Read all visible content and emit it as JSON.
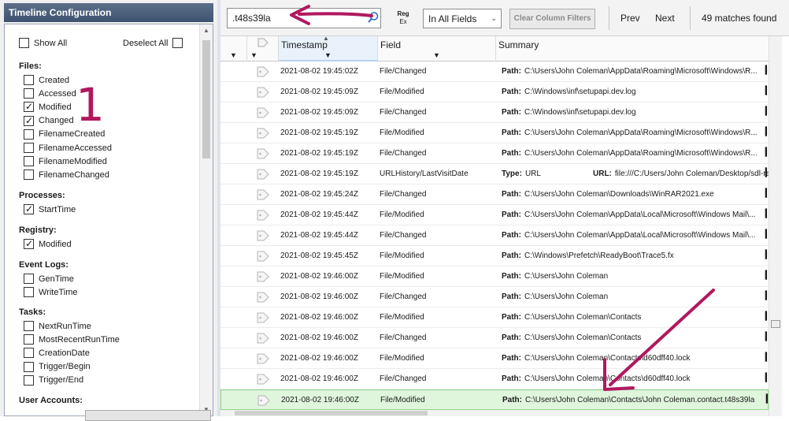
{
  "left_panel": {
    "title": "Timeline Configuration",
    "show_all": {
      "label": "Show All",
      "checked": false
    },
    "deselect_all": {
      "label": "Deselect All",
      "checked": false
    },
    "sections": [
      {
        "heading": "Files:",
        "items": [
          {
            "label": "Created",
            "checked": false
          },
          {
            "label": "Accessed",
            "checked": false
          },
          {
            "label": "Modified",
            "checked": true
          },
          {
            "label": "Changed",
            "checked": true
          },
          {
            "label": "FilenameCreated",
            "checked": false
          },
          {
            "label": "FilenameAccessed",
            "checked": false
          },
          {
            "label": "FilenameModified",
            "checked": false
          },
          {
            "label": "FilenameChanged",
            "checked": false
          }
        ]
      },
      {
        "heading": "Processes:",
        "items": [
          {
            "label": "StartTime",
            "checked": true
          }
        ]
      },
      {
        "heading": "Registry:",
        "items": [
          {
            "label": "Modified",
            "checked": true
          }
        ]
      },
      {
        "heading": "Event Logs:",
        "items": [
          {
            "label": "GenTime",
            "checked": false
          },
          {
            "label": "WriteTime",
            "checked": false
          }
        ]
      },
      {
        "heading": "Tasks:",
        "items": [
          {
            "label": "NextRunTime",
            "checked": false
          },
          {
            "label": "MostRecentRunTime",
            "checked": false
          },
          {
            "label": "CreationDate",
            "checked": false
          },
          {
            "label": "Trigger/Begin",
            "checked": false
          },
          {
            "label": "Trigger/End",
            "checked": false
          }
        ]
      },
      {
        "heading": "User Accounts:",
        "items": []
      }
    ]
  },
  "toolbar": {
    "search_value": ".t48s39la",
    "regex_label_top": "Reg",
    "regex_label_bottom": "Ex",
    "field_scope": "In All Fields",
    "clear_filters_label": "Clear Column Filters",
    "prev_label": "Prev",
    "next_label": "Next",
    "match_count": "49 matches found"
  },
  "grid": {
    "columns": [
      {
        "label": ""
      },
      {
        "label": ""
      },
      {
        "label": "Timestamp"
      },
      {
        "label": "Field"
      },
      {
        "label": "Summary"
      }
    ],
    "rows": [
      {
        "ts": "2021-08-02 19:45:02Z",
        "field": "File/Changed",
        "key": "Path:",
        "value": "C:\\Users\\John Coleman\\AppData\\Roaming\\Microsoft\\Windows\\R..."
      },
      {
        "ts": "2021-08-02 19:45:09Z",
        "field": "File/Modified",
        "key": "Path:",
        "value": "C:\\Windows\\inf\\setupapi.dev.log"
      },
      {
        "ts": "2021-08-02 19:45:09Z",
        "field": "File/Changed",
        "key": "Path:",
        "value": "C:\\Windows\\inf\\setupapi.dev.log"
      },
      {
        "ts": "2021-08-02 19:45:19Z",
        "field": "File/Modified",
        "key": "Path:",
        "value": "C:\\Users\\John Coleman\\AppData\\Roaming\\Microsoft\\Windows\\R..."
      },
      {
        "ts": "2021-08-02 19:45:19Z",
        "field": "File/Changed",
        "key": "Path:",
        "value": "C:\\Users\\John Coleman\\AppData\\Roaming\\Microsoft\\Windows\\R..."
      },
      {
        "ts": "2021-08-02 19:45:19Z",
        "field": "URLHistory/LastVisitDate",
        "key": "Type:",
        "value": "URL",
        "url_key": "URL:",
        "url_value": "file:///C:/Users/John Coleman/Desktop/sdl-re"
      },
      {
        "ts": "2021-08-02 19:45:24Z",
        "field": "File/Changed",
        "key": "Path:",
        "value": "C:\\Users\\John Coleman\\Downloads\\WinRAR2021.exe"
      },
      {
        "ts": "2021-08-02 19:45:44Z",
        "field": "File/Modified",
        "key": "Path:",
        "value": "C:\\Users\\John Coleman\\AppData\\Local\\Microsoft\\Windows Mail\\..."
      },
      {
        "ts": "2021-08-02 19:45:44Z",
        "field": "File/Changed",
        "key": "Path:",
        "value": "C:\\Users\\John Coleman\\AppData\\Local\\Microsoft\\Windows Mail\\..."
      },
      {
        "ts": "2021-08-02 19:45:45Z",
        "field": "File/Modified",
        "key": "Path:",
        "value": "C:\\Windows\\Prefetch\\ReadyBoot\\Trace5.fx"
      },
      {
        "ts": "2021-08-02 19:46:00Z",
        "field": "File/Modified",
        "key": "Path:",
        "value": "C:\\Users\\John Coleman"
      },
      {
        "ts": "2021-08-02 19:46:00Z",
        "field": "File/Changed",
        "key": "Path:",
        "value": "C:\\Users\\John Coleman"
      },
      {
        "ts": "2021-08-02 19:46:00Z",
        "field": "File/Modified",
        "key": "Path:",
        "value": "C:\\Users\\John Coleman\\Contacts"
      },
      {
        "ts": "2021-08-02 19:46:00Z",
        "field": "File/Changed",
        "key": "Path:",
        "value": "C:\\Users\\John Coleman\\Contacts"
      },
      {
        "ts": "2021-08-02 19:46:00Z",
        "field": "File/Modified",
        "key": "Path:",
        "value": "C:\\Users\\John Coleman\\Contacts\\d60dff40.lock"
      },
      {
        "ts": "2021-08-02 19:46:00Z",
        "field": "File/Changed",
        "key": "Path:",
        "value": "C:\\Users\\John Coleman\\Contacts\\d60dff40.lock"
      },
      {
        "ts": "2021-08-02 19:46:00Z",
        "field": "File/Modified",
        "key": "Path:",
        "value": "C:\\Users\\John Coleman\\Contacts\\John Coleman.contact.t48s39la",
        "selected": true
      }
    ]
  },
  "annotations": {
    "number_label": "1",
    "color": "#b0185e"
  }
}
